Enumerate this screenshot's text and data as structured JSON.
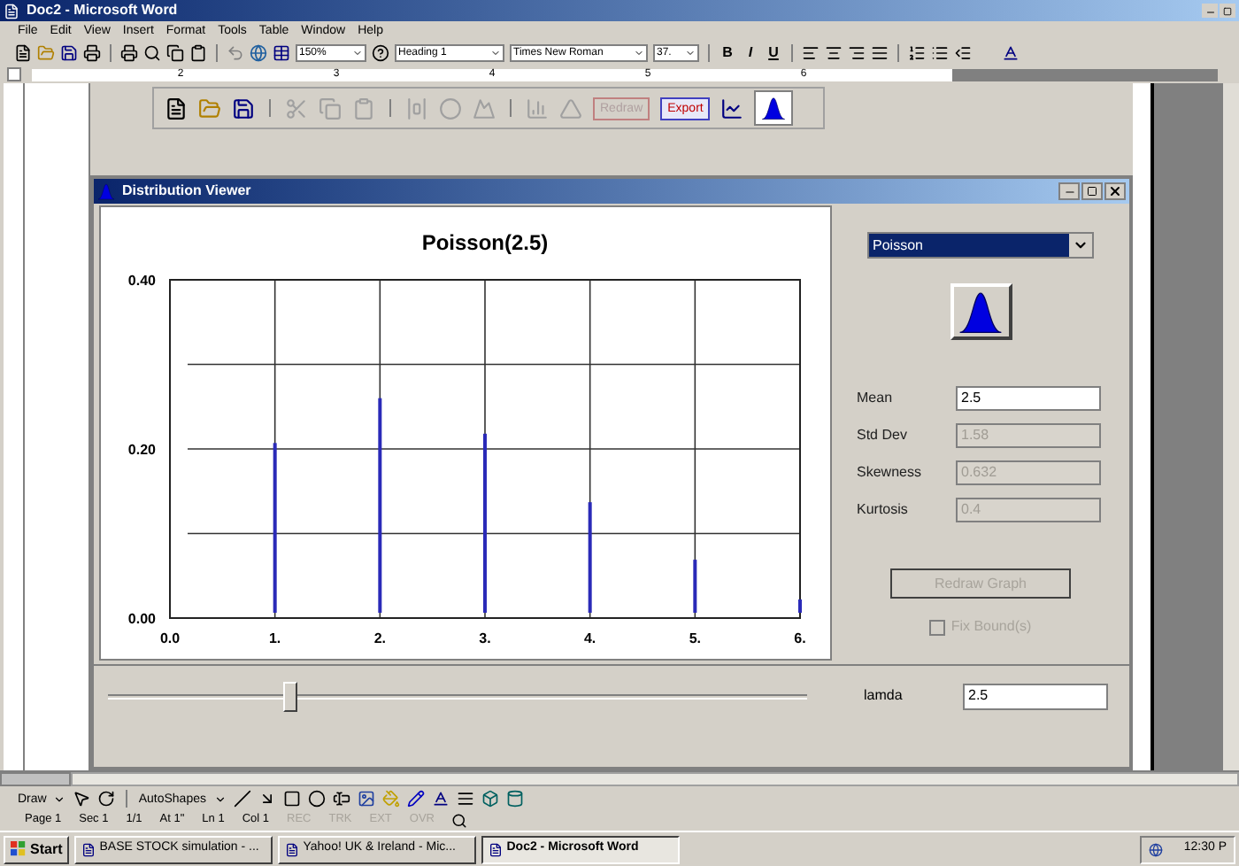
{
  "window": {
    "title": "Doc2 - Microsoft Word"
  },
  "menu": [
    "File",
    "Edit",
    "View",
    "Insert",
    "Format",
    "Tools",
    "Table",
    "Window",
    "Help"
  ],
  "toolbar": {
    "zoom": "150%",
    "style": "Heading 1",
    "font": "Times New Roman",
    "size": "37.",
    "format_buttons": [
      "B",
      "I",
      "U"
    ]
  },
  "ruler": {
    "marks": [
      "2",
      "3",
      "4",
      "5",
      "6"
    ]
  },
  "embedded_toolbar": {
    "buttons": [
      {
        "label": "Redraw",
        "disabled": true
      },
      {
        "label": "Export",
        "disabled": false
      }
    ]
  },
  "viewer": {
    "title": "Distribution Viewer",
    "chart_data": {
      "type": "bar",
      "grid": true,
      "title": "Poisson(2.5)",
      "x": [
        1,
        2,
        3,
        4,
        5,
        6
      ],
      "values": [
        0.207,
        0.26,
        0.218,
        0.137,
        0.069,
        0.022
      ],
      "xlim": [
        0,
        6
      ],
      "ylim": [
        0,
        0.4
      ],
      "xticks": [
        {
          "value": 0,
          "label": "0.0"
        },
        {
          "value": 1,
          "label": "1."
        },
        {
          "value": 2,
          "label": "2."
        },
        {
          "value": 3,
          "label": "3."
        },
        {
          "value": 4,
          "label": "4."
        },
        {
          "value": 5,
          "label": "5."
        },
        {
          "value": 6,
          "label": "6."
        }
      ],
      "yticks": [
        {
          "value": 0,
          "label": "0.00"
        },
        {
          "value": 0.2,
          "label": "0.20"
        },
        {
          "value": 0.4,
          "label": "0.40"
        }
      ]
    },
    "distribution": "Poisson",
    "stats": [
      {
        "label": "Mean",
        "value": "2.5",
        "disabled": false
      },
      {
        "label": "Std Dev",
        "value": "1.58",
        "disabled": true
      },
      {
        "label": "Skewness",
        "value": "0.632",
        "disabled": true
      },
      {
        "label": "Kurtosis",
        "value": "0.4",
        "disabled": true
      }
    ],
    "redraw_button": {
      "label": "Redraw Graph",
      "disabled": true
    },
    "fix_bounds": {
      "label": "Fix Bound(s)",
      "checked": false,
      "disabled": true
    },
    "slider": {
      "level": 0.26
    },
    "param": {
      "label": "lamda",
      "value": "2.5"
    }
  },
  "draw_toolbar": {
    "draw": "Draw",
    "autoshapes": "AutoShapes"
  },
  "status_bar": [
    "Page 1",
    "Sec 1",
    "1/1",
    "At 1\"",
    "Ln 1",
    "Col 1"
  ],
  "status_modes": [
    {
      "label": "REC",
      "on": false
    },
    {
      "label": "TRK",
      "on": false
    },
    {
      "label": "EXT",
      "on": false
    },
    {
      "label": "OVR",
      "on": false
    }
  ],
  "taskbar": {
    "start": "Start",
    "tasks": [
      {
        "label": "BASE STOCK simulation - ...",
        "selected": false
      },
      {
        "label": "Yahoo! UK & Ireland - Mic...",
        "selected": false
      },
      {
        "label": "Doc2 - Microsoft Word",
        "selected": true
      }
    ],
    "clock": "12:30 P"
  }
}
